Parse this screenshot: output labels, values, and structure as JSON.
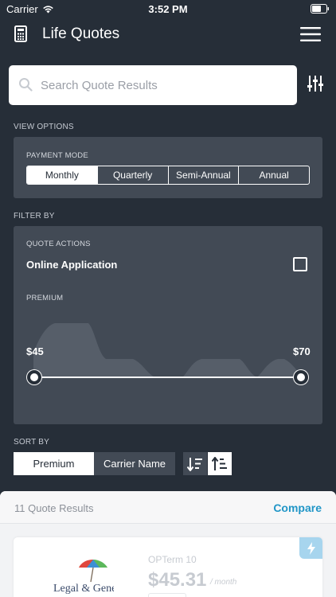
{
  "status_bar": {
    "carrier": "Carrier",
    "time": "3:52 PM"
  },
  "nav": {
    "title": "Life Quotes"
  },
  "search": {
    "placeholder": "Search Quote Results"
  },
  "view_options": {
    "label": "VIEW OPTIONS",
    "payment_mode_label": "PAYMENT MODE",
    "modes": [
      "Monthly",
      "Quarterly",
      "Semi-Annual",
      "Annual"
    ],
    "selected_mode": "Monthly"
  },
  "filter_by": {
    "label": "FILTER BY",
    "quote_actions_label": "QUOTE ACTIONS",
    "online_application_label": "Online Application",
    "online_application_checked": false,
    "premium_label": "PREMIUM",
    "premium_min": "$45",
    "premium_max": "$70"
  },
  "sort_by": {
    "label": "SORT BY",
    "options": [
      "Premium",
      "Carrier Name"
    ],
    "selected": "Premium"
  },
  "results": {
    "count_label": "11 Quote Results",
    "compare_label": "Compare",
    "quotes": [
      {
        "carrier_logo_text": "Legal & General",
        "plan": "OPTerm 10",
        "price": "$45.31",
        "per": "/ month"
      }
    ]
  },
  "colors": {
    "background": "#262e38",
    "panel": "#424a55",
    "accent": "#2196c7",
    "tag": "#a7d5ee"
  }
}
